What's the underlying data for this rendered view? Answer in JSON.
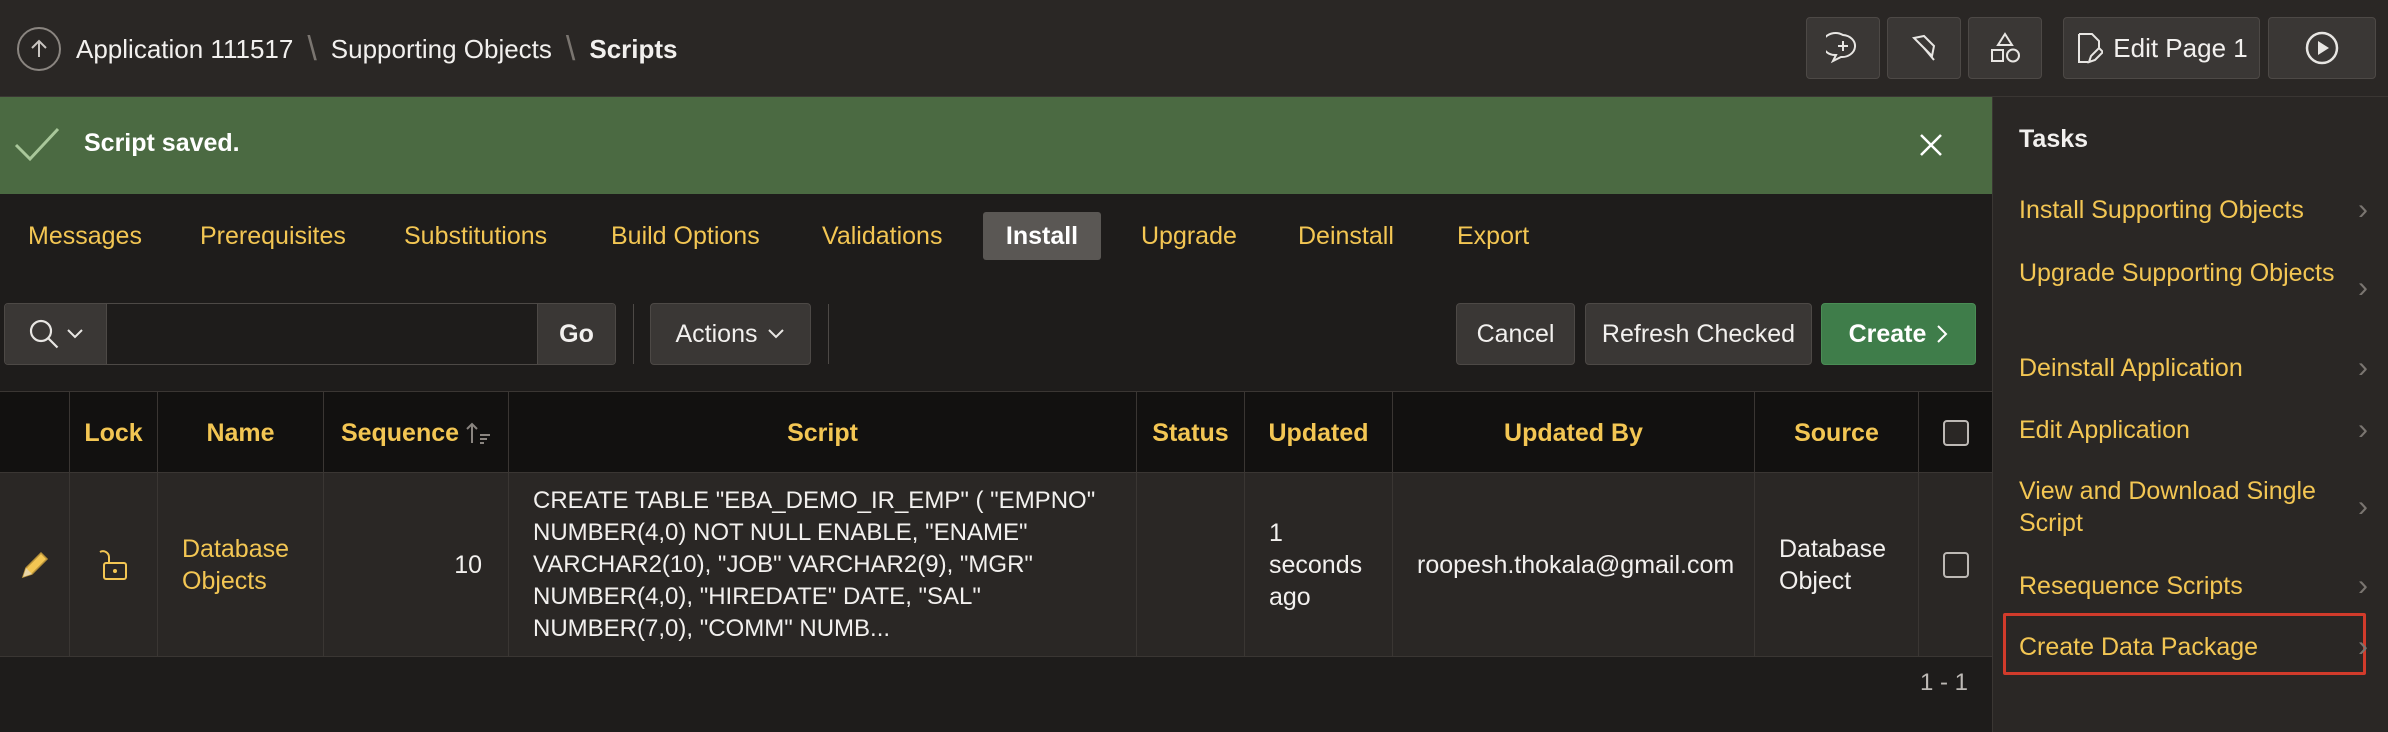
{
  "header": {
    "breadcrumb": [
      "Application 111517",
      "Supporting Objects",
      "Scripts"
    ],
    "edit_page_label": "Edit Page 1"
  },
  "banner": {
    "message": "Script saved."
  },
  "tabs": [
    "Messages",
    "Prerequisites",
    "Substitutions",
    "Build Options",
    "Validations",
    "Install",
    "Upgrade",
    "Deinstall",
    "Export"
  ],
  "active_tab": "Install",
  "toolbar": {
    "go_label": "Go",
    "actions_label": "Actions",
    "cancel_label": "Cancel",
    "refresh_label": "Refresh Checked",
    "create_label": "Create"
  },
  "table": {
    "columns": [
      "Lock",
      "Name",
      "Sequence",
      "Script",
      "Status",
      "Updated",
      "Updated By",
      "Source"
    ],
    "rows": [
      {
        "name": "Database Objects",
        "sequence": "10",
        "script": "CREATE TABLE \"EBA_DEMO_IR_EMP\" ( \"EMPNO\" NUMBER(4,0) NOT NULL ENABLE, \"ENAME\" VARCHAR2(10), \"JOB\" VARCHAR2(9), \"MGR\" NUMBER(4,0), \"HIREDATE\" DATE, \"SAL\" NUMBER(7,0), \"COMM\" NUMB...",
        "status": "",
        "updated": "1 seconds ago",
        "updated_by": "roopesh.thokala@gmail.com",
        "source": "Database Object"
      }
    ],
    "pagination": "1 - 1"
  },
  "tasks": {
    "title": "Tasks",
    "items": [
      "Install Supporting Objects",
      "Upgrade Supporting Objects",
      "Deinstall Application",
      "Edit Application",
      "View and Download Single Script",
      "Resequence Scripts",
      "Create Data Package"
    ]
  },
  "colors": {
    "accent": "#f3c653",
    "banner": "#4b6a42",
    "create": "#3f7d4a",
    "highlight": "#d13b2b"
  }
}
